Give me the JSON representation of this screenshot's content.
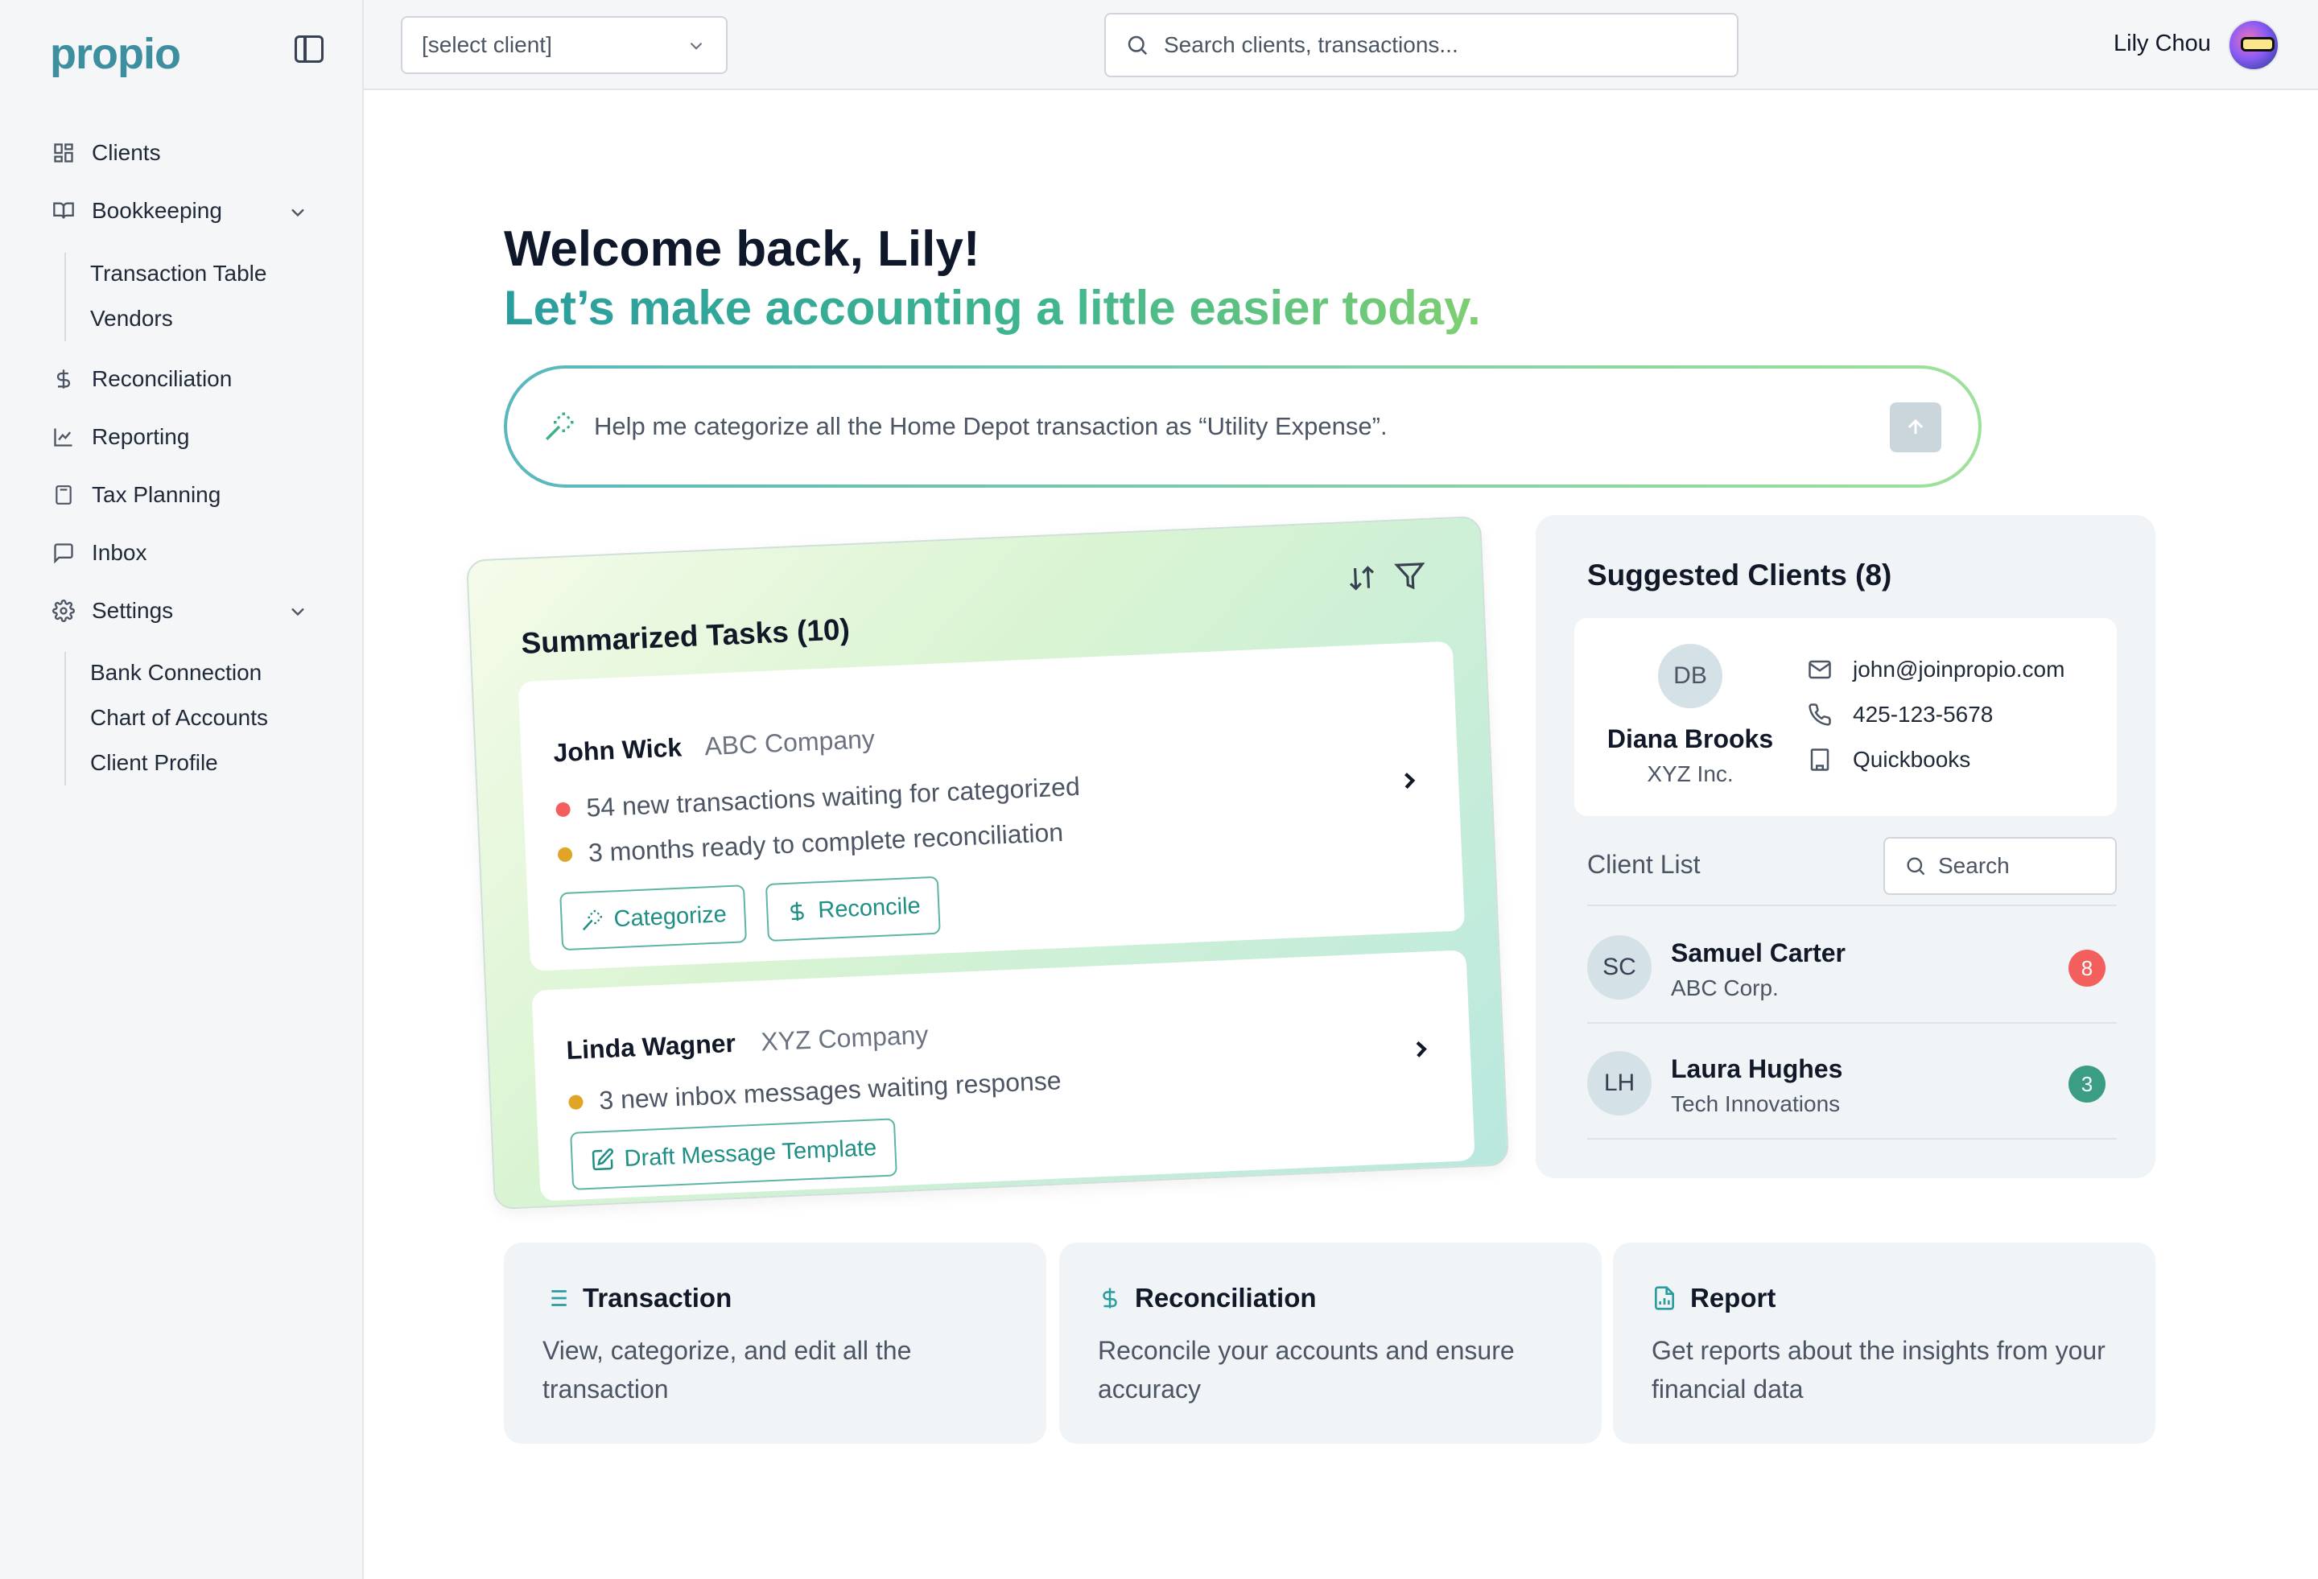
{
  "app": {
    "logo": "propio"
  },
  "sidebar": {
    "items": [
      {
        "label": "Clients"
      },
      {
        "label": "Bookkeeping"
      },
      {
        "label": "Reconciliation"
      },
      {
        "label": "Reporting"
      },
      {
        "label": "Tax Planning"
      },
      {
        "label": "Inbox"
      },
      {
        "label": "Settings"
      }
    ],
    "bookkeeping_sub": [
      "Transaction Table",
      "Vendors"
    ],
    "settings_sub": [
      "Bank Connection",
      "Chart of Accounts",
      "Client Profile"
    ]
  },
  "topbar": {
    "client_select": "[select client]",
    "search_placeholder": "Search clients, transactions...",
    "user_name": "Lily Chou"
  },
  "hero": {
    "welcome": "Welcome back, Lily!",
    "tagline": "Let’s make accounting a little easier today.",
    "prompt": "Help me categorize all the Home Depot transaction as “Utility Expense”."
  },
  "tasks": {
    "title": "Summarized Tasks (10)",
    "items": [
      {
        "name": "John Wick",
        "company": "ABC Company",
        "lines": [
          "54 new transactions waiting for categorized",
          "3 months ready to complete reconciliation"
        ],
        "actions": [
          "Categorize",
          "Reconcile"
        ]
      },
      {
        "name": "Linda Wagner",
        "company": "XYZ Company",
        "lines": [
          "3 new inbox messages waiting response"
        ],
        "actions": [
          "Draft Message Template"
        ]
      }
    ]
  },
  "suggested": {
    "title": "Suggested Clients (8)",
    "featured": {
      "initials": "DB",
      "name": "Diana Brooks",
      "company": "XYZ Inc.",
      "email": "john@joinpropio.com",
      "phone": "425-123-5678",
      "software": "Quickbooks"
    },
    "list_label": "Client List",
    "search_placeholder": "Search",
    "clients": [
      {
        "initials": "SC",
        "name": "Samuel Carter",
        "company": "ABC Corp.",
        "count": "8"
      },
      {
        "initials": "LH",
        "name": "Laura Hughes",
        "company": "Tech Innovations",
        "count": "3"
      }
    ]
  },
  "features": [
    {
      "title": "Transaction",
      "desc": "View, categorize, and edit all the transaction"
    },
    {
      "title": "Reconciliation",
      "desc": "Reconcile your accounts and ensure accuracy"
    },
    {
      "title": "Report",
      "desc": "Get reports about the insights from your financial data"
    }
  ],
  "colors": {
    "brand": "#3d8fa0",
    "accent": "#2a9d9f",
    "red": "#f25f5c",
    "amber": "#e0a526",
    "green": "#3a9d84"
  }
}
